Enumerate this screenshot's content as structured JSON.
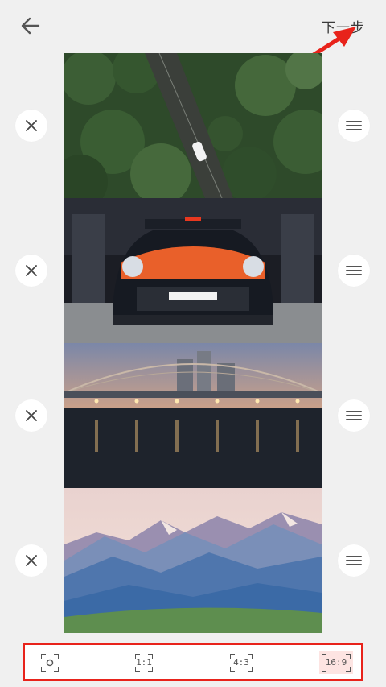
{
  "header": {
    "back_icon": "arrow-left-icon",
    "next_label": "下一步"
  },
  "photos": [
    {
      "name": "forest-road",
      "remove_icon": "close-icon",
      "drag_icon": "drag-handle-icon"
    },
    {
      "name": "race-car",
      "remove_icon": "close-icon",
      "drag_icon": "drag-handle-icon"
    },
    {
      "name": "bridge-night",
      "remove_icon": "close-icon",
      "drag_icon": "drag-handle-icon"
    },
    {
      "name": "mountains",
      "remove_icon": "close-icon",
      "drag_icon": "drag-handle-icon"
    }
  ],
  "ratio_options": [
    {
      "label": "",
      "icon": "original-frame-icon",
      "selected": false
    },
    {
      "label": "1:1",
      "selected": false
    },
    {
      "label": "4:3",
      "selected": false
    },
    {
      "label": "16:9",
      "selected": true
    }
  ],
  "colors": {
    "annotation_red": "#e8231b",
    "selected_bg": "#fde4e2",
    "background": "#f0f0f0"
  }
}
